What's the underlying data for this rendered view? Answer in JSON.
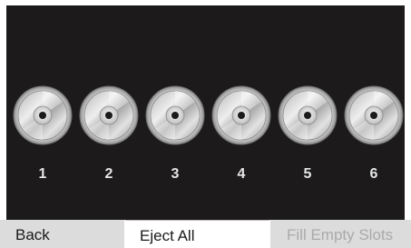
{
  "slots": [
    {
      "number": "1"
    },
    {
      "number": "2"
    },
    {
      "number": "3"
    },
    {
      "number": "4"
    },
    {
      "number": "5"
    },
    {
      "number": "6"
    }
  ],
  "disc_icon": "cd-disc-icon",
  "softkeys": {
    "back": "Back",
    "eject_all": "Eject All",
    "fill_empty_slots": "Fill Empty Slots"
  },
  "colors": {
    "screen_background": "#1c1a1b",
    "softkey_bar": "#dcdcdc",
    "softkey_selected": "#ffffff",
    "softkey_disabled_text": "#aaaaaa"
  }
}
